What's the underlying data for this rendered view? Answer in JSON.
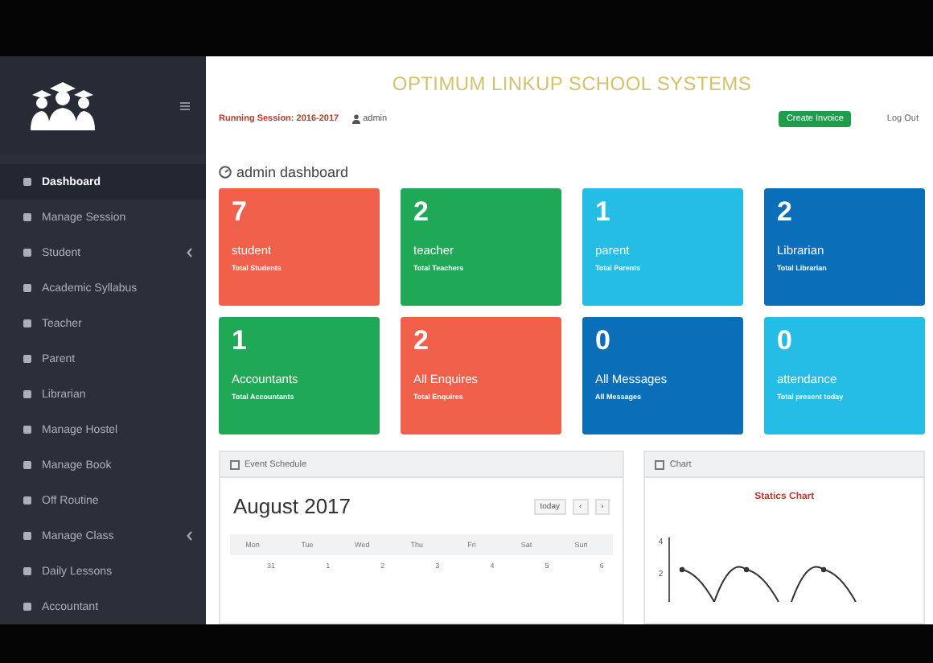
{
  "sidebar": {
    "items": [
      {
        "label": "Dashboard",
        "selected": true,
        "expandable": false
      },
      {
        "label": "Manage Session",
        "selected": false,
        "expandable": false
      },
      {
        "label": "Student",
        "selected": false,
        "expandable": true
      },
      {
        "label": "Academic Syllabus",
        "selected": false,
        "expandable": false
      },
      {
        "label": "Teacher",
        "selected": false,
        "expandable": false
      },
      {
        "label": "Parent",
        "selected": false,
        "expandable": false
      },
      {
        "label": "Librarian",
        "selected": false,
        "expandable": false
      },
      {
        "label": "Manage Hostel",
        "selected": false,
        "expandable": false
      },
      {
        "label": "Manage Book",
        "selected": false,
        "expandable": false
      },
      {
        "label": "Off Routine",
        "selected": false,
        "expandable": false
      },
      {
        "label": "Manage Class",
        "selected": false,
        "expandable": true
      },
      {
        "label": "Daily Lessons",
        "selected": false,
        "expandable": false
      },
      {
        "label": "Accountant",
        "selected": false,
        "expandable": false
      }
    ]
  },
  "header": {
    "title": "OPTIMUM LINKUP SCHOOL SYSTEMS",
    "session": "Running Session: 2016-2017",
    "user": "admin",
    "action_button": "Create Invoice",
    "logout": "Log Out"
  },
  "page_title": "admin dashboard",
  "cards": [
    {
      "count": "7",
      "label": "student",
      "caption": "Total Students",
      "color": "#f0604a"
    },
    {
      "count": "2",
      "label": "teacher",
      "caption": "Total Teachers",
      "color": "#1fa855"
    },
    {
      "count": "1",
      "label": "parent",
      "caption": "Total Parents",
      "color": "#25bde6"
    },
    {
      "count": "2",
      "label": "Librarian",
      "caption": "Total Librarian",
      "color": "#0a6eb8"
    },
    {
      "count": "1",
      "label": "Accountants",
      "caption": "Total Accountants",
      "color": "#1fa855"
    },
    {
      "count": "2",
      "label": "All Enquires",
      "caption": "Total Enquires",
      "color": "#f0604a"
    },
    {
      "count": "0",
      "label": "All Messages",
      "caption": "All Messages",
      "color": "#0a6eb8"
    },
    {
      "count": "0",
      "label": "attendance",
      "caption": "Total present today",
      "color": "#25bde6"
    }
  ],
  "calendar_panel": {
    "title": "Event Schedule",
    "month": "August 2017",
    "today_button": "today",
    "prev": "‹",
    "next": "›",
    "weekdays": [
      "Mon",
      "Tue",
      "Wed",
      "Thu",
      "Fri",
      "Sat",
      "Sun"
    ],
    "dates": [
      "31",
      "1",
      "2",
      "3",
      "4",
      "5",
      "6"
    ]
  },
  "chart_panel": {
    "title": "Chart",
    "chart_title": "Statics Chart",
    "y_labels": [
      "4",
      "2"
    ]
  }
}
